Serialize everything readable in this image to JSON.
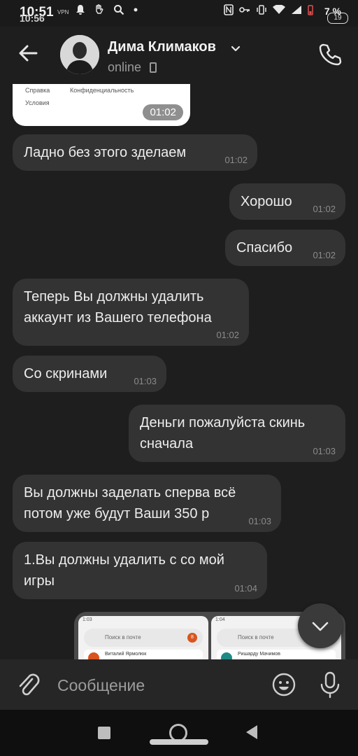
{
  "status_bar": {
    "time": "10:51",
    "time_secondary": "10:56",
    "vpn": "VPN",
    "battery_percent": "7 %",
    "battery_level": "19"
  },
  "header": {
    "contact_name": "Дима Климаков",
    "status": "online"
  },
  "chat": {
    "screenshot_top": {
      "links": [
        "Справка",
        "Конфиденциальность",
        "Условия"
      ],
      "time": "01:02"
    },
    "messages": [
      {
        "side": "in",
        "text": "Ладно без этого зделаем",
        "time": "01:02"
      },
      {
        "side": "out",
        "text": "Хорошо",
        "time": "01:02"
      },
      {
        "side": "out",
        "text": "Спасибо",
        "time": "01:02"
      },
      {
        "side": "in",
        "text": "Теперь Вы должны удалить аккаунт из Вашего телефона",
        "time": "01:02"
      },
      {
        "side": "in",
        "text": "Со скринами",
        "time": "01:03"
      },
      {
        "side": "out",
        "text": "Деньги пожалуйста скинь сначала",
        "time": "01:03"
      },
      {
        "side": "in",
        "text": "Вы должны заделать сперва всё потом уже будут Ваши 350 р",
        "time": "01:03"
      },
      {
        "side": "in",
        "text": "1.Вы должны удалить с со мой игры",
        "time": "01:04"
      }
    ],
    "screenshot_bottom": {
      "left": {
        "status_time": "1:03",
        "search_placeholder": "Поиск в почте",
        "badge": "8",
        "sender": "Виталий Ярмолюк"
      },
      "right": {
        "status_time": "1:04",
        "search_placeholder": "Поиск в почте",
        "sender": "Ришарду Мачимов"
      }
    }
  },
  "input": {
    "placeholder": "Сообщение"
  },
  "colors": {
    "background": "#1e1e1e",
    "bubble": "#333333",
    "avatar_orange": "#d9541e",
    "avatar_teal": "#1f8a84"
  }
}
